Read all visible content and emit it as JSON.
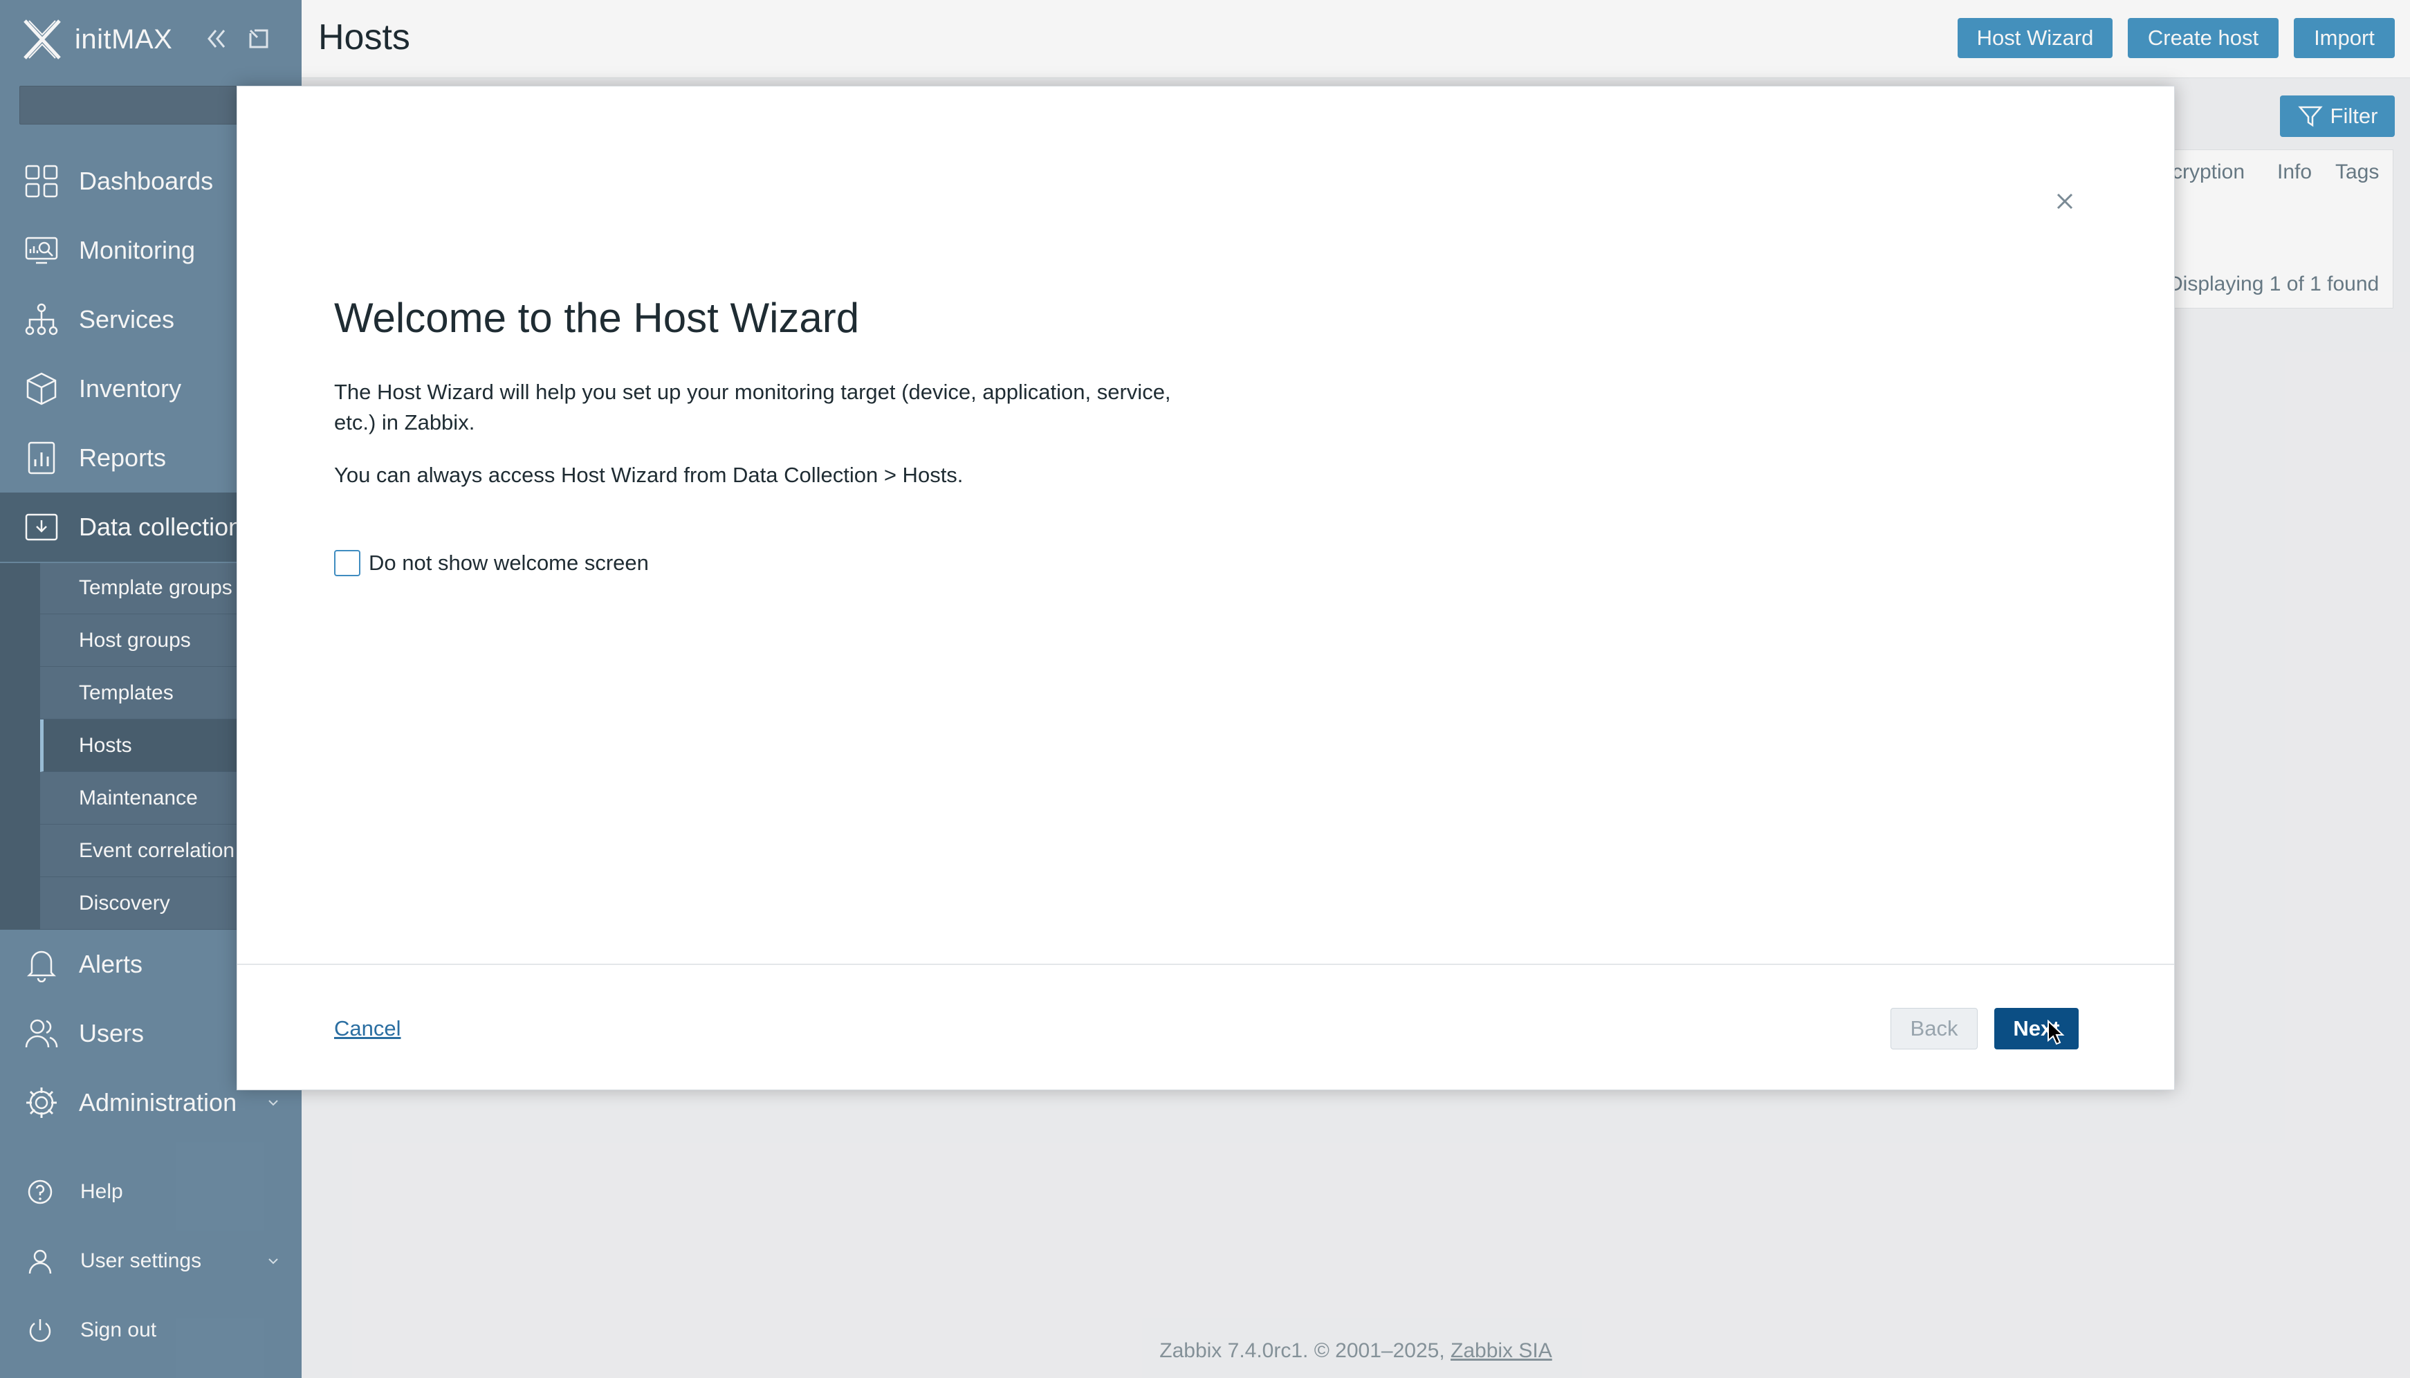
{
  "sidebar": {
    "brand": "initMAX",
    "nav": [
      {
        "label": "Dashboards",
        "icon": "dashboards-icon"
      },
      {
        "label": "Monitoring",
        "icon": "monitoring-icon"
      },
      {
        "label": "Services",
        "icon": "services-icon"
      },
      {
        "label": "Inventory",
        "icon": "inventory-icon"
      },
      {
        "label": "Reports",
        "icon": "reports-icon"
      },
      {
        "label": "Data collection",
        "icon": "data-collection-icon"
      },
      {
        "label": "Alerts",
        "icon": "alerts-icon"
      },
      {
        "label": "Users",
        "icon": "users-icon"
      },
      {
        "label": "Administration",
        "icon": "administration-icon"
      }
    ],
    "submenu": [
      {
        "label": "Template groups"
      },
      {
        "label": "Host groups"
      },
      {
        "label": "Templates"
      },
      {
        "label": "Hosts"
      },
      {
        "label": "Maintenance"
      },
      {
        "label": "Event correlation"
      },
      {
        "label": "Discovery"
      }
    ],
    "bottom": [
      {
        "label": "Help",
        "icon": "help-icon"
      },
      {
        "label": "User settings",
        "icon": "user-settings-icon"
      },
      {
        "label": "Sign out",
        "icon": "sign-out-icon"
      }
    ]
  },
  "header": {
    "title": "Hosts",
    "buttons": {
      "host_wizard": "Host Wizard",
      "create_host": "Create host",
      "import": "Import"
    },
    "filter_label": "Filter"
  },
  "table": {
    "columns_visible": [
      "cryption",
      "Info",
      "Tags"
    ],
    "found_text": "Displaying 1 of 1 found"
  },
  "modal": {
    "title": "Welcome to the Host Wizard",
    "intro": "The Host Wizard will help you set up your monitoring target (device, application, service, etc.) in Zabbix.",
    "access_note": "You can always access Host Wizard from Data Collection > Hosts.",
    "checkbox_label": "Do not show welcome screen",
    "checkbox_checked": false,
    "cancel": "Cancel",
    "back": "Back",
    "next": "Next"
  },
  "footer": {
    "text": "Zabbix 7.4.0rc1. © 2001–2025,",
    "link": "Zabbix SIA"
  },
  "colors": {
    "sidebar": "#6d8ba2",
    "primary_button": "#4796c4",
    "next_button": "#0b4e84"
  }
}
